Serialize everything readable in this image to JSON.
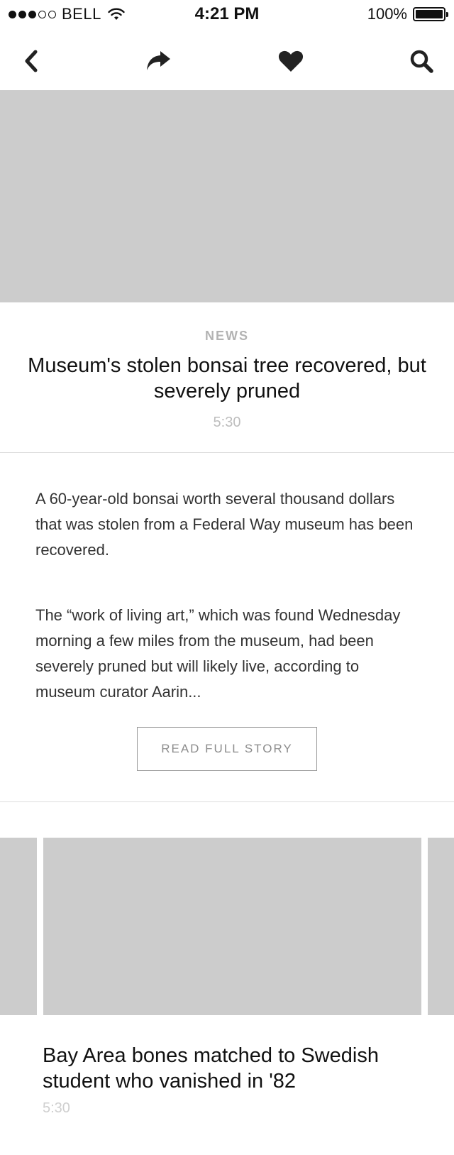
{
  "status_bar": {
    "carrier": "BELL",
    "time": "4:21 PM",
    "battery_text": "100%",
    "signal_strength": 3,
    "signal_max": 5,
    "battery_level": 1.0
  },
  "nav": {
    "icons": [
      "back-chevron-icon",
      "share-icon",
      "heart-icon",
      "search-icon"
    ]
  },
  "article": {
    "category": "NEWS",
    "headline": "Museum's stolen bonsai tree recovered, but severely pruned",
    "time": "5:30",
    "paragraphs": [
      "A 60-year-old bonsai worth several thousand dollars that was stolen from a Federal Way museum has been recovered.",
      "The “work of living art,” which was found Wednesday morning a few miles from the museum, had been severely pruned but will likely live, according to museum curator Aarin..."
    ],
    "read_more_label": "READ FULL STORY"
  },
  "related": {
    "current_card": {
      "title": "Bay Area bones matched to Swedish student who vanished in '82",
      "time": "5:30"
    }
  },
  "colors": {
    "placeholder": "#cccccc",
    "muted_text": "#b3b3b3",
    "divider": "#dddddd"
  }
}
